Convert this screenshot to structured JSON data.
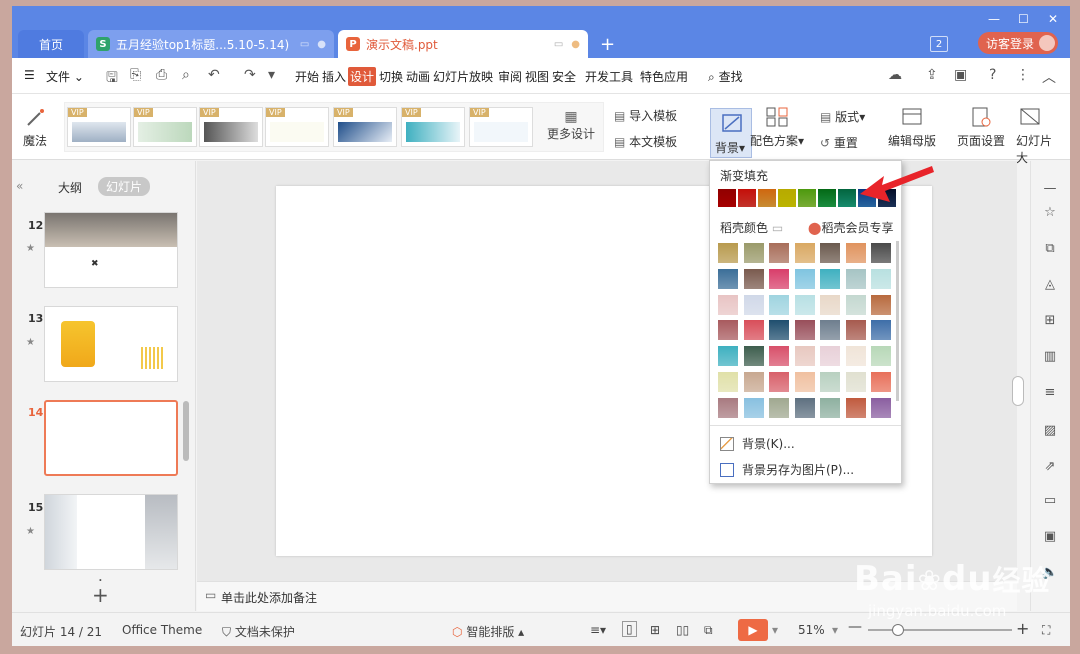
{
  "tabs": {
    "home": "首页",
    "doc1": "五月经验top1标题...5.10-5.14)",
    "doc2": "演示文稿.ppt",
    "count": "2",
    "login": "访客登录"
  },
  "menu": {
    "file": "文件",
    "items": [
      "开始",
      "插入",
      "设计",
      "切换",
      "动画",
      "幻灯片放映",
      "审阅",
      "视图",
      "安全",
      "开发工具",
      "特色应用"
    ],
    "search": "查找"
  },
  "ribbon": {
    "magic": "魔法",
    "vip": "VIP",
    "more_design": "更多设计",
    "import_template": "导入模板",
    "this_template": "本文模板",
    "background": "背景",
    "color_scheme": "配色方案",
    "layout": "版式",
    "reset": "重置",
    "edit_master": "编辑母版",
    "page_setup": "页面设置",
    "slide_size": "幻灯片大"
  },
  "left_panel": {
    "outline_tab": "大纲",
    "slides_tab": "幻灯片",
    "slides": [
      {
        "num": "12"
      },
      {
        "num": "13"
      },
      {
        "num": "14"
      },
      {
        "num": "15"
      }
    ]
  },
  "notes_placeholder": "单击此处添加备注",
  "dropdown": {
    "gradient_title": "渐变填充",
    "gradient_colors": [
      "#c00000",
      "#e03c31",
      "#e6a23c",
      "#d8d000",
      "#8cc63e",
      "#1fa34a",
      "#1aa07e",
      "#2e75b6",
      "#1f3864"
    ],
    "palette_title": "稻壳颜色",
    "vip_label": "稻壳会员专享",
    "palette": [
      [
        "#b89a4e",
        "#9a9a6a",
        "#a86e5a",
        "#d9a862",
        "#6b5a4e",
        "#e0935e",
        "#4a4a4a"
      ],
      [
        "#3b6e98",
        "#7a5a4e",
        "#d83e6a",
        "#7fc4e0",
        "#3fb0c0",
        "#a6c4c4",
        "#b8e0e0"
      ],
      [
        "#e8c4c4",
        "#d0d8e8",
        "#9fd4e0",
        "#b8e0e4",
        "#e8d8c8",
        "#c4d8d0",
        "#b86a3e"
      ],
      [
        "#a85a5e",
        "#d84e5a",
        "#1f4e6e",
        "#984e5a",
        "#6e7e8e",
        "#a65a4e",
        "#3e6ea8"
      ],
      [
        "#3eb0c0",
        "#3e5e4e",
        "#d8506a",
        "#e8c8c0",
        "#e8d0d8",
        "#f0e4d8",
        "#b8d8b8"
      ],
      [
        "#e0e0a8",
        "#c8a890",
        "#d8606a",
        "#f0c0a0",
        "#b8d0c0",
        "#e0e0d0",
        "#e8705a"
      ],
      [
        "#a87a80",
        "#88c0e0",
        "#a0a890",
        "#5e7080",
        "#8eb0a0",
        "#c05a3e",
        "#8a5ea0"
      ]
    ],
    "background_item": "背景(K)...",
    "save_bg_item": "背景另存为图片(P)..."
  },
  "status": {
    "slide_info": "幻灯片 14 / 21",
    "theme": "Office Theme",
    "protect": "文档未保护",
    "smart_layout": "智能排版",
    "zoom": "51%"
  },
  "watermark": {
    "brand": "Bai",
    "brand2": "du",
    "jy": "经验",
    "url": "jingyan.baidu.com"
  }
}
